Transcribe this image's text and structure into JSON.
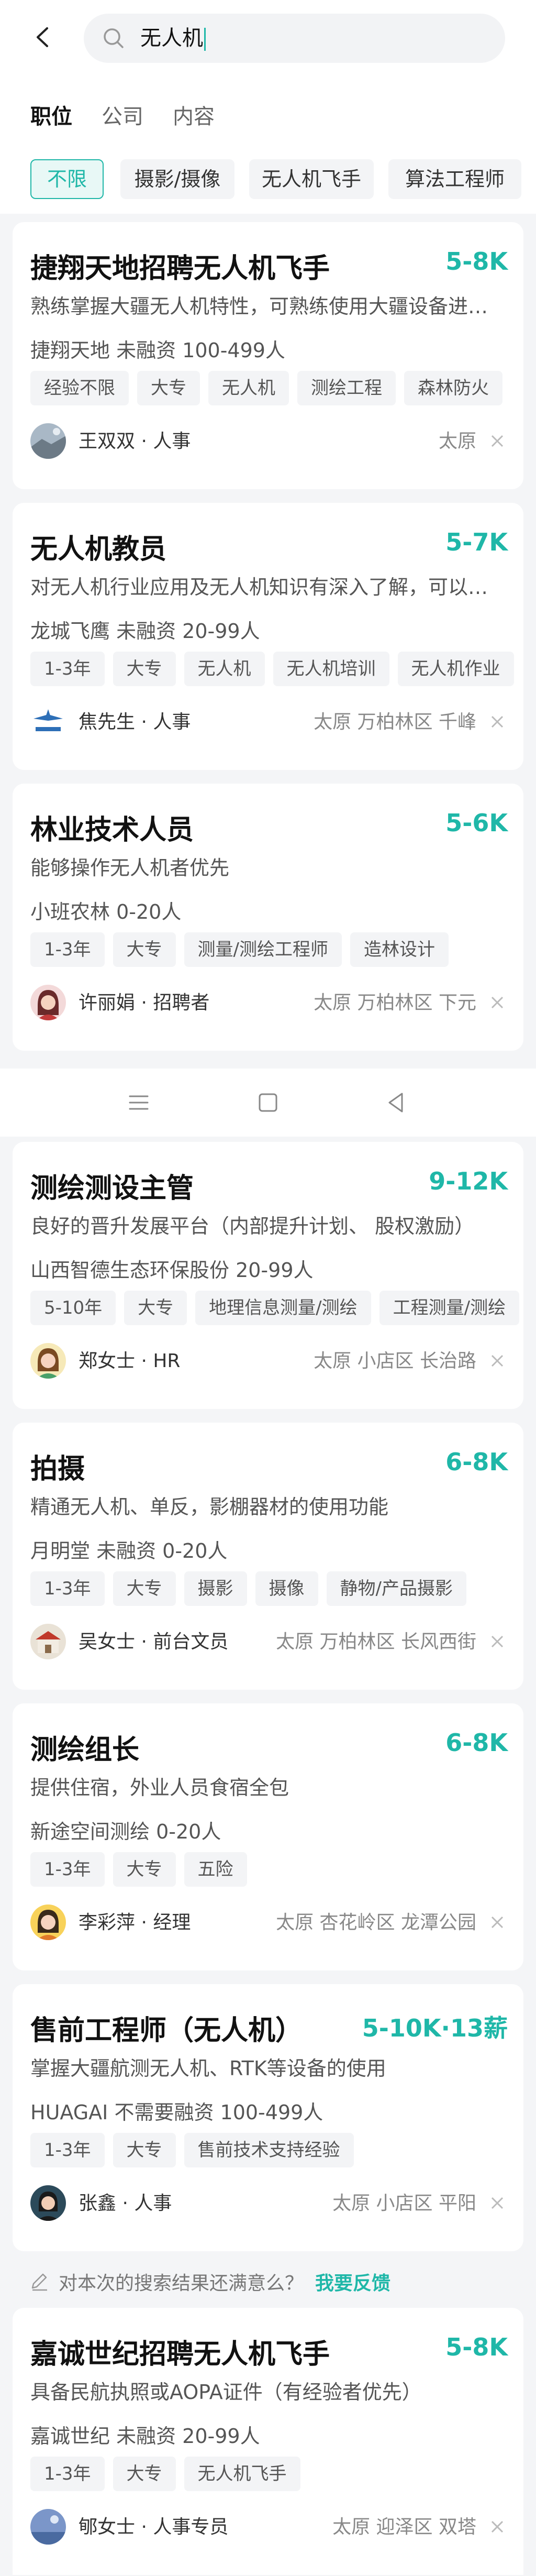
{
  "search": {
    "query": "无人机"
  },
  "categories": [
    "职位",
    "公司",
    "内容"
  ],
  "filters": [
    "不限",
    "摄影/摄像",
    "无人机飞手",
    "算法工程师"
  ],
  "colors": {
    "accent": "#1fb7a8",
    "background": "#f4f5f7"
  },
  "jobs": [
    {
      "title": "捷翔天地招聘无人机飞手",
      "salary": "5-8K",
      "desc": "熟练掌握大疆无人机特性，可熟练使用大疆设备进…",
      "company": "捷翔天地  未融资  100-499人",
      "tags": [
        "经验不限",
        "大专",
        "无人机",
        "测绘工程",
        "森林防火"
      ],
      "recruiter": "王双双 · 人事",
      "location": "太原"
    },
    {
      "title": "无人机教员",
      "salary": "5-7K",
      "desc": "对无人机行业应用及无人机知识有深入了解，可以…",
      "company": "龙城飞鹰  未融资  20-99人",
      "tags": [
        "1-3年",
        "大专",
        "无人机",
        "无人机培训",
        "无人机作业"
      ],
      "recruiter": "焦先生 · 人事",
      "location": "太原  万柏林区  千峰"
    },
    {
      "title": "林业技术人员",
      "salary": "5-6K",
      "desc": "能够操作无人机者优先",
      "company": "小班农林  0-20人",
      "tags": [
        "1-3年",
        "大专",
        "测量/测绘工程师",
        "造林设计"
      ],
      "recruiter": "许丽娟 · 招聘者",
      "location": "太原  万柏林区  下元"
    },
    {
      "title": "测绘测设主管",
      "salary": "9-12K",
      "desc": "良好的晋升发展平台（内部提升计划、 股权激励）",
      "company": "山西智德生态环保股份  20-99人",
      "tags": [
        "5-10年",
        "大专",
        "地理信息测量/测绘",
        "工程测量/测绘"
      ],
      "recruiter": "郑女士 · HR",
      "location": "太原  小店区  长治路"
    },
    {
      "title": "拍摄",
      "salary": "6-8K",
      "desc": "精通无人机、单反，影棚器材的使用功能",
      "company": "月明堂  未融资  0-20人",
      "tags": [
        "1-3年",
        "大专",
        "摄影",
        "摄像",
        "静物/产品摄影"
      ],
      "recruiter": "吴女士 · 前台文员",
      "location": "太原  万柏林区  长风西街"
    },
    {
      "title": "测绘组长",
      "salary": "6-8K",
      "desc": "提供住宿，外业人员食宿全包",
      "company": "新途空间测绘  0-20人",
      "tags": [
        "1-3年",
        "大专",
        "五险"
      ],
      "recruiter": "李彩萍 · 经理",
      "location": "太原  杏花岭区  龙潭公园"
    },
    {
      "title": "售前工程师（无人机）",
      "salary": "5-10K·13薪",
      "desc": "掌握大疆航测无人机、RTK等设备的使用",
      "company": "HUAGAI  不需要融资  100-499人",
      "tags": [
        "1-3年",
        "大专",
        "售前技术支持经验"
      ],
      "recruiter": "张鑫 · 人事",
      "location": "太原  小店区  平阳"
    },
    {
      "title": "嘉诚世纪招聘无人机飞手",
      "salary": "5-8K",
      "desc": "具备民航执照或AOPA证件（有经验者优先）",
      "company": "嘉诚世纪  未融资  20-99人",
      "tags": [
        "1-3年",
        "大专",
        "无人机飞手"
      ],
      "recruiter": "郇女士 · 人事专员",
      "location": "太原  迎泽区  双塔"
    }
  ],
  "feedback": {
    "question": "对本次的搜索结果还满意么？",
    "link": "我要反馈"
  }
}
